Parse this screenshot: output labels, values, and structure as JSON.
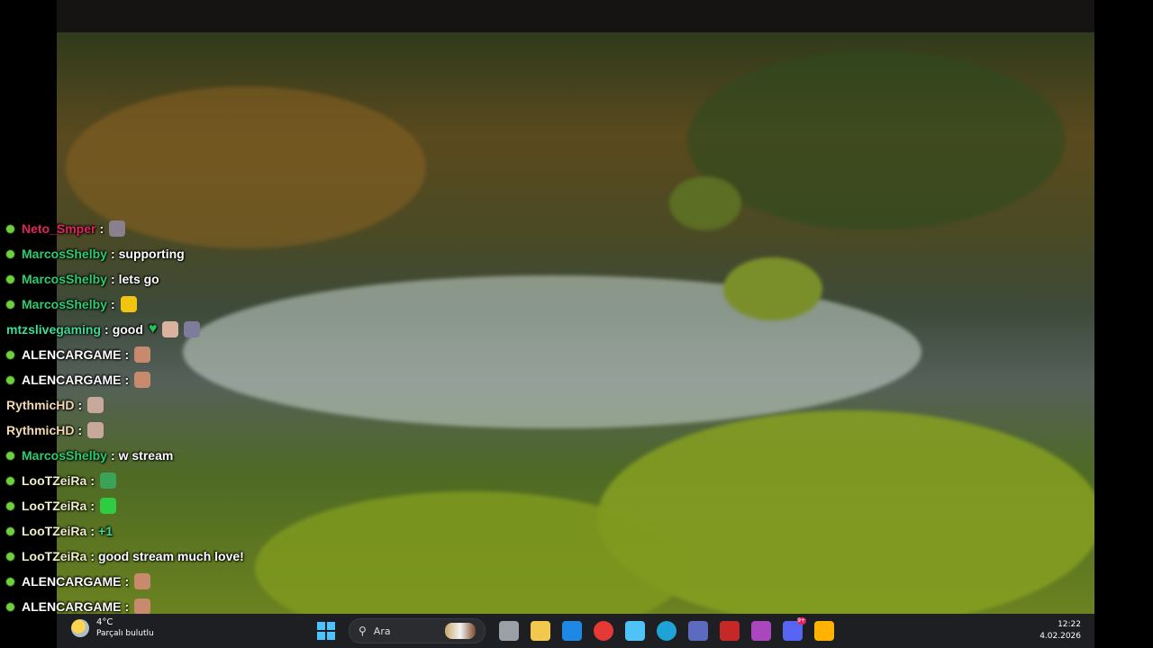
{
  "chat": {
    "messages": [
      {
        "user": "Neto_Smper",
        "color": "#e0245e",
        "badge": true,
        "text": "",
        "emotes": [
          "#8a7f8c"
        ]
      },
      {
        "user": "MarcosShelby",
        "color": "#2ecc71",
        "badge": true,
        "text": "supporting",
        "emotes": []
      },
      {
        "user": "MarcosShelby",
        "color": "#2ecc71",
        "badge": true,
        "text": "lets go",
        "emotes": []
      },
      {
        "user": "MarcosShelby",
        "color": "#2ecc71",
        "badge": true,
        "text": "",
        "emotes": [
          "#f1c40f"
        ]
      },
      {
        "user": "mtzslivegaming",
        "color": "#3ddc97",
        "badge": false,
        "text": "good",
        "emotes": [
          "#d9b3a0",
          "#7d7d9b"
        ],
        "heart": true
      },
      {
        "user": "ALENCARGAME",
        "color": "#ffffff",
        "badge": true,
        "text": "",
        "emotes": [
          "#c88a6d"
        ]
      },
      {
        "user": "ALENCARGAME",
        "color": "#ffffff",
        "badge": true,
        "text": "",
        "emotes": [
          "#c88a6d"
        ]
      },
      {
        "user": "RythmicHD",
        "color": "#f3d9b1",
        "badge": false,
        "text": "",
        "emotes": [
          "#c8a89a"
        ]
      },
      {
        "user": "RythmicHD",
        "color": "#f3d9b1",
        "badge": false,
        "text": "",
        "emotes": [
          "#c8a89a"
        ]
      },
      {
        "user": "MarcosShelby",
        "color": "#2ecc71",
        "badge": true,
        "text": "w stream",
        "emotes": []
      },
      {
        "user": "LooTZeiRa",
        "color": "#f0f0c8",
        "badge": true,
        "text": "",
        "emotes": [
          "#3aa35a"
        ]
      },
      {
        "user": "LooTZeiRa",
        "color": "#f0f0c8",
        "badge": true,
        "text": "",
        "emotes": [
          "#2ecc40"
        ]
      },
      {
        "user": "LooTZeiRa",
        "color": "#f0f0c8",
        "badge": true,
        "text": "+1",
        "emotes": []
      },
      {
        "user": "LooTZeiRa",
        "color": "#f0f0c8",
        "badge": true,
        "text": "good stream much love!",
        "emotes": []
      },
      {
        "user": "ALENCARGAME",
        "color": "#ffffff",
        "badge": true,
        "text": "",
        "emotes": [
          "#c88a6d"
        ]
      },
      {
        "user": "ALENCARGAME",
        "color": "#ffffff",
        "badge": true,
        "text": "",
        "emotes": [
          "#c88a6d"
        ]
      }
    ],
    "separator": ":"
  },
  "taskbar": {
    "weather": {
      "temp": "4°C",
      "condition": "Parçalı bulutlu",
      "icon": "partly-cloudy-icon"
    },
    "search": {
      "placeholder": "Ara",
      "icon": "search-icon"
    },
    "clock": {
      "time": "12:22",
      "date": "4.02.2026"
    },
    "discord_badge": "9+",
    "apps": [
      {
        "name": "task-view-icon",
        "color": "#9aa0a6"
      },
      {
        "name": "file-explorer-icon",
        "color": "#f2c94c"
      },
      {
        "name": "outlook-icon",
        "color": "#1e88e5"
      },
      {
        "name": "chrome-icon",
        "color": "#e53935"
      },
      {
        "name": "microsoft-store-icon",
        "color": "#4fc3f7"
      },
      {
        "name": "edge-icon",
        "color": "#1fa2d6"
      },
      {
        "name": "calculator-icon",
        "color": "#5c6bc0"
      },
      {
        "name": "red-circle-app-icon",
        "color": "#c62828"
      },
      {
        "name": "obs-like-app-icon",
        "color": "#ab47bc"
      },
      {
        "name": "discord-icon",
        "color": "#5865f2"
      },
      {
        "name": "colorful-app-icon",
        "color": "#ffb300"
      }
    ]
  }
}
